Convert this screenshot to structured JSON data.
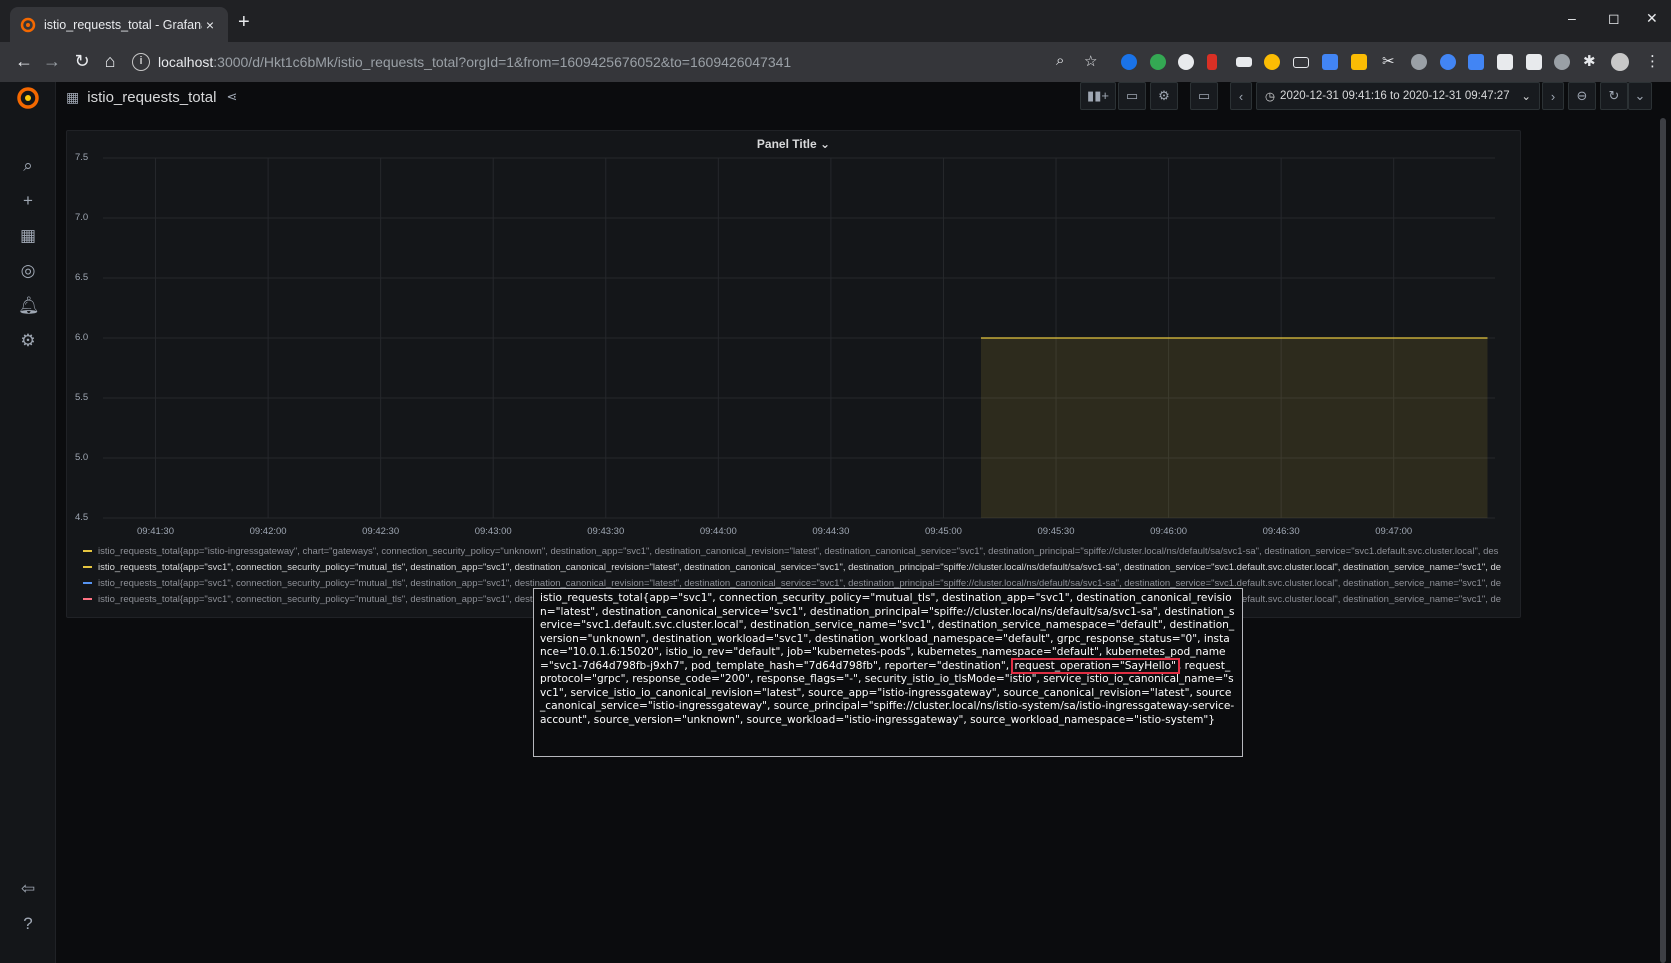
{
  "browser": {
    "tab_title": "istio_requests_total - Grafana",
    "tab_close": "×",
    "new_tab": "+",
    "url_host": "localhost",
    "url_path": ":3000/d/Hkt1c6bMk/istio_requests_total?orgId=1&from=1609425676052&to=1609426047341",
    "info_icon": "i"
  },
  "dashboard": {
    "title": "istio_requests_total",
    "time_range": "2020-12-31 09:41:16 to 2020-12-31 09:47:27"
  },
  "panel": {
    "title": "Panel Title ⌄"
  },
  "chart_data": {
    "type": "line",
    "title": "Panel Title",
    "x_ticks": [
      "09:41:30",
      "09:42:00",
      "09:42:30",
      "09:43:00",
      "09:43:30",
      "09:44:00",
      "09:44:30",
      "09:45:00",
      "09:45:30",
      "09:46:00",
      "09:46:30",
      "09:47:00"
    ],
    "y_ticks": [
      "7.5",
      "7.0",
      "6.5",
      "6.0",
      "5.5",
      "5.0",
      "4.5"
    ],
    "ylim": [
      4.5,
      7.5
    ],
    "xlim": [
      "09:41:16",
      "09:47:27"
    ],
    "grid": true,
    "fill": true,
    "series": [
      {
        "color": "#e5c540",
        "x": [
          "09:45:10",
          "09:47:25"
        ],
        "values": [
          6,
          6
        ]
      }
    ],
    "legend": [
      {
        "color": "#e5c540",
        "label": "istio_requests_total{app=\"istio-ingressgateway\", chart=\"gateways\", connection_security_policy=\"unknown\", destination_app=\"svc1\", destination_canonical_revision=\"latest\", destination_canonical_service=\"svc1\", destination_principal=\"spiffe://cluster.local/ns/default/sa/svc1-sa\", destination_service=\"svc1.default.svc.cluster.local\", des"
      },
      {
        "color": "#e5c540",
        "label": "istio_requests_total{app=\"svc1\", connection_security_policy=\"mutual_tls\", destination_app=\"svc1\", destination_canonical_revision=\"latest\", destination_canonical_service=\"svc1\", destination_principal=\"spiffe://cluster.local/ns/default/sa/svc1-sa\", destination_service=\"svc1.default.svc.cluster.local\", destination_service_name=\"svc1\", de"
      },
      {
        "color": "#5794f2",
        "label": "istio_requests_total{app=\"svc1\", connection_security_policy=\"mutual_tls\", destination_app=\"svc1\", destination_canonical_revision=\"latest\", destination_canonical_service=\"svc1\", destination_principal=\"spiffe://cluster.local/ns/default/sa/svc1-sa\", destination_service=\"svc1.default.svc.cluster.local\", destination_service_name=\"svc1\", de"
      },
      {
        "color": "#ff7383",
        "label": "istio_requests_total{app=\"svc1\", connection_security_policy=\"mutual_tls\", destination_app=\"svc1\", destination_canonical_revision=\"latest\", destination_canonical_service=\"svc1\", destination_principal=\"spiffe://cluster.local/ns/default/sa/svc1-sa\", destination_service=\"svc1.default.svc.cluster.local\", destination_service_name=\"svc1\", de"
      }
    ]
  },
  "tooltip": {
    "before": "istio_requests_total{app=\"svc1\", connection_security_policy=\"mutual_tls\", destination_app=\"svc1\", destination_canonical_revision=\"latest\", destination_canonical_service=\"svc1\", destination_principal=\"spiffe://cluster.local/ns/default/sa/svc1-sa\", destination_service=\"svc1.default.svc.cluster.local\", destination_service_name=\"svc1\", destination_service_namespace=\"default\", destination_version=\"unknown\", destination_workload=\"svc1\", destination_workload_namespace=\"default\", grpc_response_status=\"0\", instance=\"10.0.1.6:15020\", istio_io_rev=\"default\", job=\"kubernetes-pods\", kubernetes_namespace=\"default\", kubernetes_pod_name=\"svc1-7d64d798fb-j9xh7\", pod_template_hash=\"7d64d798fb\", reporter=\"destination\", ",
    "highlight": "request_operation=\"SayHello\"",
    "after": ", request_protocol=\"grpc\", response_code=\"200\", response_flags=\"-\", security_istio_io_tlsMode=\"istio\", service_istio_io_canonical_name=\"svc1\", service_istio_io_canonical_revision=\"latest\", source_app=\"istio-ingressgateway\", source_canonical_revision=\"latest\", source_canonical_service=\"istio-ingressgateway\", source_principal=\"spiffe://cluster.local/ns/istio-system/sa/istio-ingressgateway-service-account\", source_version=\"unknown\", source_workload=\"istio-ingressgateway\", source_workload_namespace=\"istio-system\"}"
  }
}
